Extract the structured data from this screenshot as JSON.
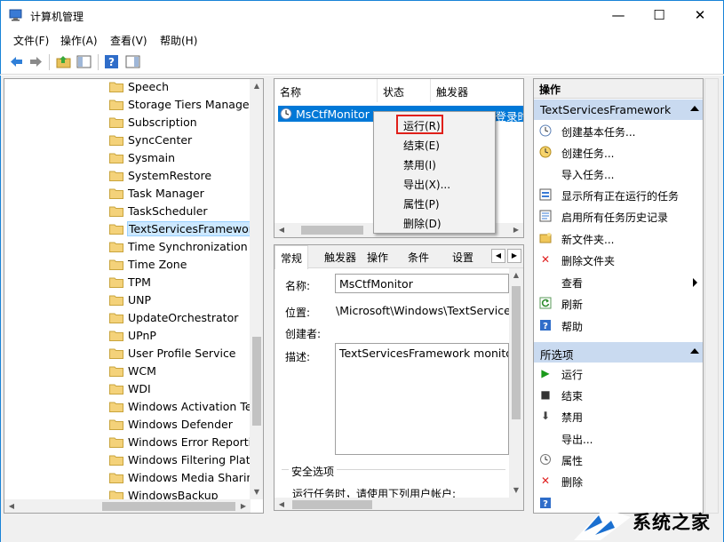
{
  "window": {
    "title": "计算机管理"
  },
  "menu": [
    "文件(F)",
    "操作(A)",
    "查看(V)",
    "帮助(H)"
  ],
  "tree": {
    "items": [
      "Speech",
      "Storage Tiers Managen",
      "Subscription",
      "SyncCenter",
      "Sysmain",
      "SystemRestore",
      "Task Manager",
      "TaskScheduler",
      "TextServicesFramework",
      "Time Synchronization",
      "Time Zone",
      "TPM",
      "UNP",
      "UpdateOrchestrator",
      "UPnP",
      "User Profile Service",
      "WCM",
      "WDI",
      "Windows Activation Tec",
      "Windows Defender",
      "Windows Error Reportin",
      "Windows Filtering Platfo",
      "Windows Media Sharin",
      "WindowsBackup"
    ],
    "selected": "TextServicesFramework"
  },
  "task_list": {
    "columns": [
      "名称",
      "状态",
      "触发器"
    ],
    "row": {
      "name": "MsCtfMonitor",
      "status": "正在运行",
      "trigger": "当任何用户登录时"
    }
  },
  "context_menu": [
    "运行(R)",
    "结束(E)",
    "禁用(I)",
    "导出(X)...",
    "属性(P)",
    "删除(D)"
  ],
  "details": {
    "tabs": [
      "常规",
      "触发器",
      "操作",
      "条件",
      "设置"
    ],
    "name_label": "名称:",
    "name_value": "MsCtfMonitor",
    "location_label": "位置:",
    "location_value": "\\Microsoft\\Windows\\TextServices",
    "author_label": "创建者:",
    "desc_label": "描述:",
    "desc_value": "TextServicesFramework monitor",
    "security_label": "安全选项",
    "security_text": "运行任务时，请使用下列用户帐户:"
  },
  "actions": {
    "header": "操作",
    "group1": "TextServicesFramework",
    "items1": [
      "创建基本任务...",
      "创建任务...",
      "导入任务...",
      "显示所有正在运行的任务",
      "启用所有任务历史记录",
      "新文件夹...",
      "删除文件夹",
      "查看",
      "刷新",
      "帮助"
    ],
    "group2": "所选项",
    "items2": [
      "运行",
      "结束",
      "禁用",
      "导出...",
      "属性",
      "删除"
    ]
  },
  "watermark": "系统之家",
  "colors": {
    "accent": "#0078d7",
    "group_bg": "#c9daf0",
    "highlight_box": "#e0201a"
  }
}
